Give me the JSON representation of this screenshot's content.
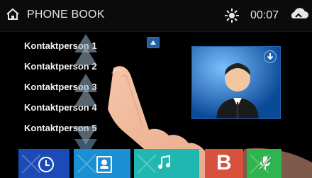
{
  "app": {
    "title": "PHONE BOOK"
  },
  "header": {
    "time": "00:07"
  },
  "contacts": {
    "items": [
      "Kontaktperson 1",
      "Kontaktperson 2",
      "Kontaktperson 3",
      "Kontaktperson 4",
      "Kontaktperson 5"
    ]
  },
  "bottom": {
    "tile_b": "B"
  },
  "colors": {
    "header_bg": "#0b0b0b",
    "accent_blue": "#1c4ab6",
    "tile_contacts": "#1a8fd3",
    "tile_media": "#20b7b1",
    "tile_bt": "#d7513d",
    "tile_mic": "#2fb44f"
  },
  "icons": [
    "home-icon",
    "sun-icon",
    "cloud-icon",
    "download-icon",
    "clock-icon",
    "contacts-icon",
    "music-icon",
    "b-icon",
    "microphone-off-icon"
  ]
}
